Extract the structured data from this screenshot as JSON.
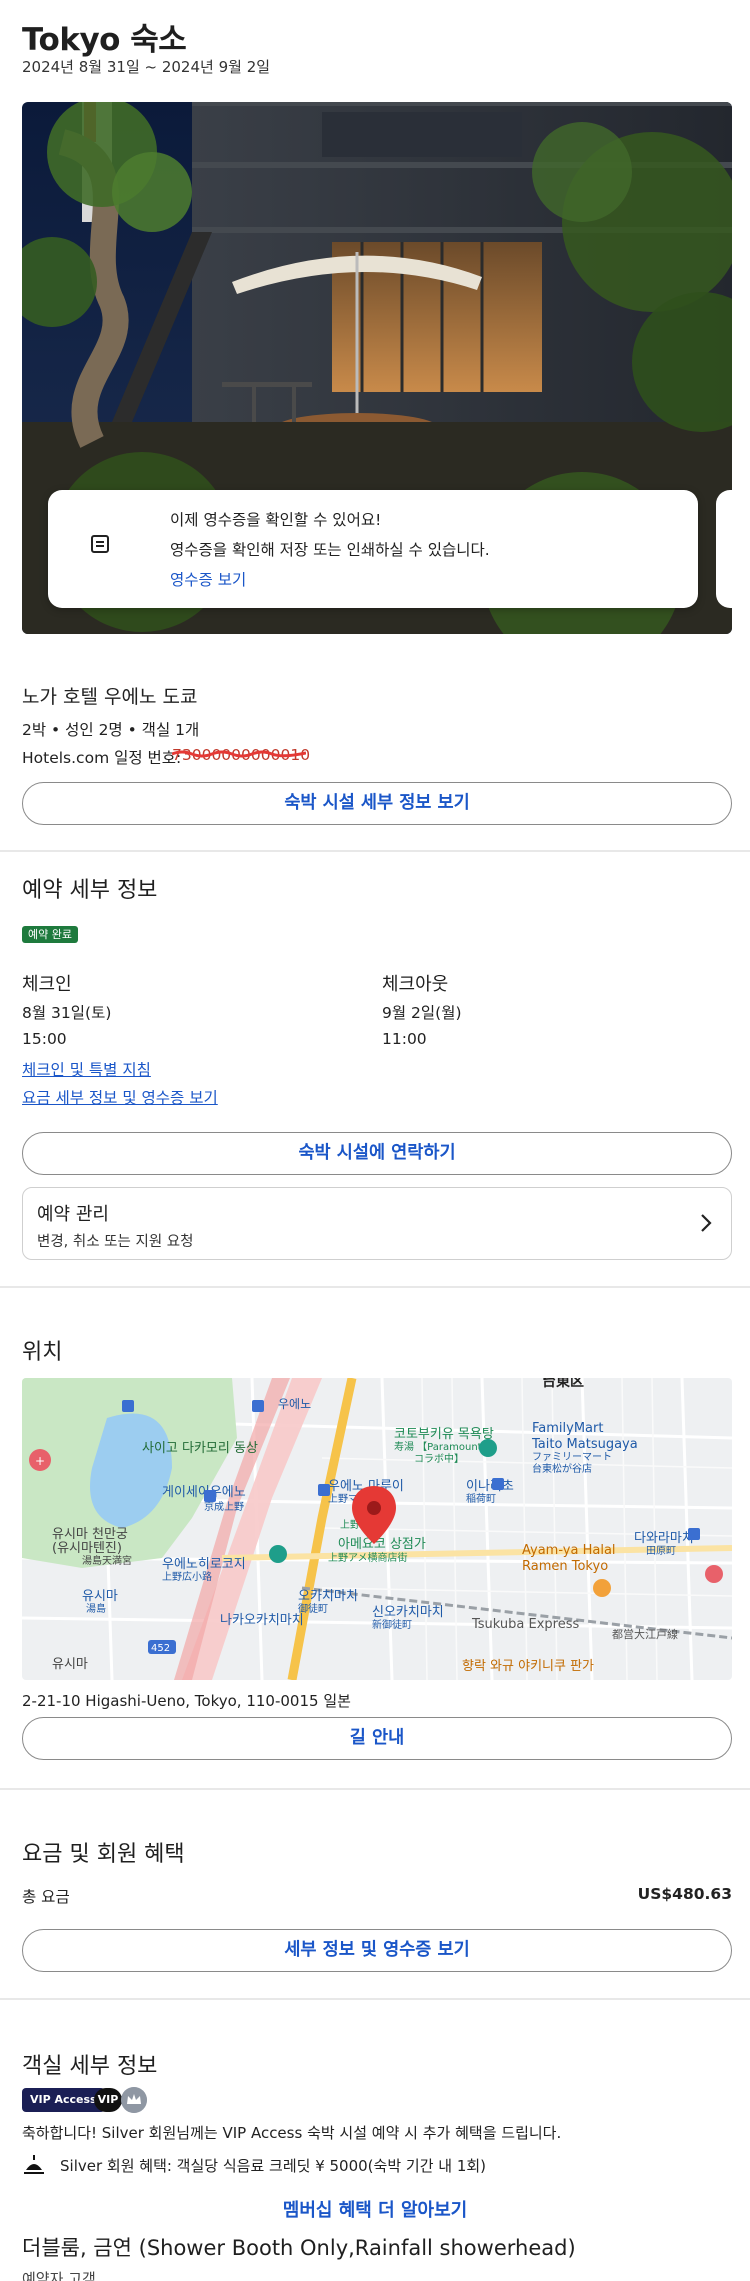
{
  "header": {
    "title": "Tokyo 숙소",
    "dates": "2024년 8월 31일 ~ 2024년 9월 2일"
  },
  "notification": {
    "line1": "이제 영수증을 확인할 수 있어요!",
    "line2": "영수증을 확인해 저장 또는 인쇄하실 수 있습니다.",
    "link": "영수증 보기",
    "icon": "receipt-icon"
  },
  "hotel": {
    "name": "노가 호텔 우에노 도쿄",
    "stay_info": "2박 • 성인 2명 • 객실 1개",
    "itinerary_label": "Hotels.com 일정 번호:",
    "itinerary_value": "73000000000010",
    "details_button": "숙박 시설 세부 정보 보기"
  },
  "booking": {
    "title": "예약 세부 정보",
    "status_badge": "예약 완료",
    "checkin_label": "체크인",
    "checkin_date": "8월 31일(토)",
    "checkin_time": "15:00",
    "checkout_label": "체크아웃",
    "checkout_date": "9월 2일(월)",
    "checkout_time": "11:00",
    "instructions_link": "체크인 및 특별 지침",
    "fee_link": "요금 세부 정보 및 영수증 보기",
    "contact_button": "숙박 시설에 연락하기",
    "manage_title": "예약 관리",
    "manage_sub": "변경, 취소 또는 지원 요청"
  },
  "location": {
    "title": "위치",
    "address": "2-21-10 Higashi-Ueno, Tokyo, 110-0015 일본",
    "directions_button": "길 안내",
    "map_labels": {
      "park": "사이고 다카모리 동상",
      "keisei": "게이세이우에노",
      "keisei_sub": "京成上野",
      "ueno_marui": "우에노 마루이",
      "ueno_marui_jp": "上野マルイ",
      "ameyoko": "아메요코 상점가",
      "ameyoko_jp": "上野アメ横商店街",
      "yushima": "유시마 천만궁",
      "yushima2": "(유시마텐진)",
      "yushima_jp": "湯島天満宮",
      "hirokoji": "우에노히로코지",
      "hirokoji_jp": "上野広小路",
      "okachimachi": "오카치마치",
      "okachimachi_jp": "御徒町",
      "nakaokachimachi": "나카오카치마치",
      "shinokachimachi": "신오카치마치",
      "shinokachimachi_jp": "新御徒町",
      "inaricho": "이나리초",
      "inaricho_jp": "稲荷町",
      "familymart1": "FamilyMart",
      "familymart2": "Taito Matsugaya",
      "familymart3": "ファミリーマート",
      "familymart4": "台東松が谷店",
      "bathhouse": "코토부키유 목욕탕",
      "bathhouse_jp": "寿湯 【Paramount+",
      "bathhouse_jp2": "コラボ中】",
      "ayamaya1": "Ayam-ya Halal",
      "ayamaya2": "Ramen Tokyo",
      "tawaramachi": "다와라마치",
      "tawaramachi_jp": "田原町",
      "tsukuba": "Tsukuba Express",
      "oedo": "都営大江戸線",
      "ueno_station": "우에노",
      "ueno_kanji": "上野",
      "yushima_station": "유시마",
      "yushima_station_jp": "湯島",
      "yushima_bottom": "유시마",
      "route": "452",
      "taito": "台東区",
      "bottom_right": "향락 와규 야키니쿠 판가"
    }
  },
  "pricing": {
    "title": "요금 및 회원 혜택",
    "total_label": "총 요금",
    "total_value": "US$480.63",
    "details_button": "세부 정보 및 영수증 보기"
  },
  "room": {
    "title": "객실 세부 정보",
    "vip_badge": "VIP Access",
    "vip_circle": "VIP",
    "vip_note": "축하합니다! Silver 회원님께는 VIP Access 숙박 시설 예약 시 추가 혜택을 드립니다.",
    "silver_benefit": "Silver 회원 혜택: 객실당 식음료 크레딧 ¥ 5000(숙박 기간 내 1회)",
    "membership_link": "멤버십 혜택 더 알아보기",
    "room_name": "더블룸, 금연 (Shower Booth Only,Rainfall showerhead)",
    "room_sub": "예약자 고객"
  },
  "colors": {
    "link": "#1a56c8",
    "badge_green": "#1e7a3d",
    "vip_navy": "#1b1f55",
    "map_pin": "#e53935"
  }
}
